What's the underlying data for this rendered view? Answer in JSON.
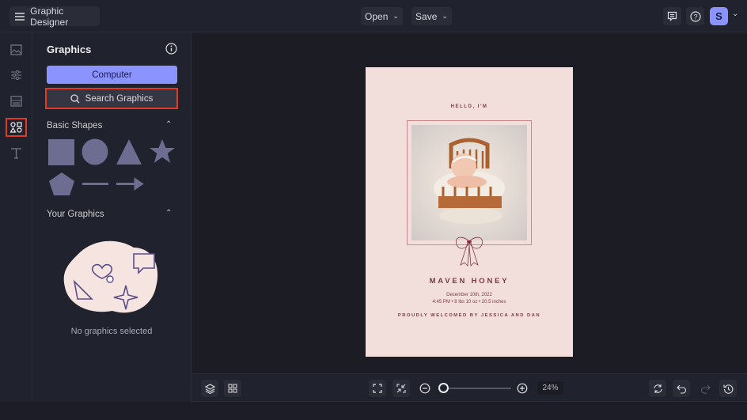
{
  "header": {
    "app_title": "Graphic Designer",
    "open_label": "Open",
    "save_label": "Save",
    "avatar_initial": "S"
  },
  "panel": {
    "title": "Graphics",
    "computer_label": "Computer",
    "search_label": "Search Graphics",
    "basic_shapes_label": "Basic Shapes",
    "your_graphics_label": "Your Graphics",
    "empty_text": "No graphics selected"
  },
  "design": {
    "greeting": "HELLO, I'M",
    "name": "MAVEN HONEY",
    "date": "December 10th, 2022",
    "details": "4:45 PM • 8 lbs 10 oz • 20.5 inches",
    "welcome": "PROUDLY WELCOMED BY JESSICA AND DAN"
  },
  "toolbar": {
    "zoom_label": "24%",
    "zoom_percent": 24
  },
  "colors": {
    "accent": "#8b93ff",
    "highlight": "#e03a22",
    "shape": "#6c6d90",
    "text": "#7a3a48"
  }
}
